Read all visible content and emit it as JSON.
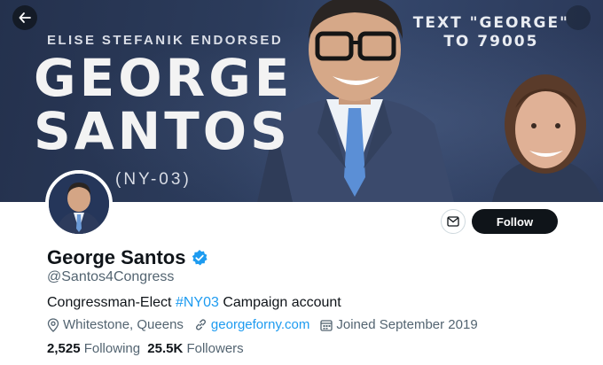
{
  "banner": {
    "endorsement": "ELISE STEFANIK ENDORSED",
    "name_line1": "GEORGE",
    "name_line2": "SANTOS",
    "district": "(NY-03)",
    "text_line1": "TEXT \"GEORGE\"",
    "text_line2": "TO 79005"
  },
  "profile": {
    "display_name": "George Santos",
    "handle": "@Santos4Congress",
    "bio_before": "Congressman-Elect ",
    "bio_hashtag": "#NY03",
    "bio_after": " Campaign account",
    "location": "Whitestone, Queens",
    "website": "georgeforny.com",
    "joined": "Joined September 2019",
    "following_count": "2,525",
    "following_label": "Following",
    "followers_count": "25.5K",
    "followers_label": "Followers"
  },
  "actions": {
    "follow_label": "Follow"
  },
  "icons": {
    "back": "arrow-left-icon",
    "message": "envelope-icon",
    "verified": "verified-badge-icon",
    "location": "location-pin-icon",
    "link": "link-icon",
    "calendar": "calendar-icon"
  },
  "colors": {
    "accent": "#1d9bf0",
    "follow_bg": "#0f1419",
    "muted_text": "#536471"
  }
}
